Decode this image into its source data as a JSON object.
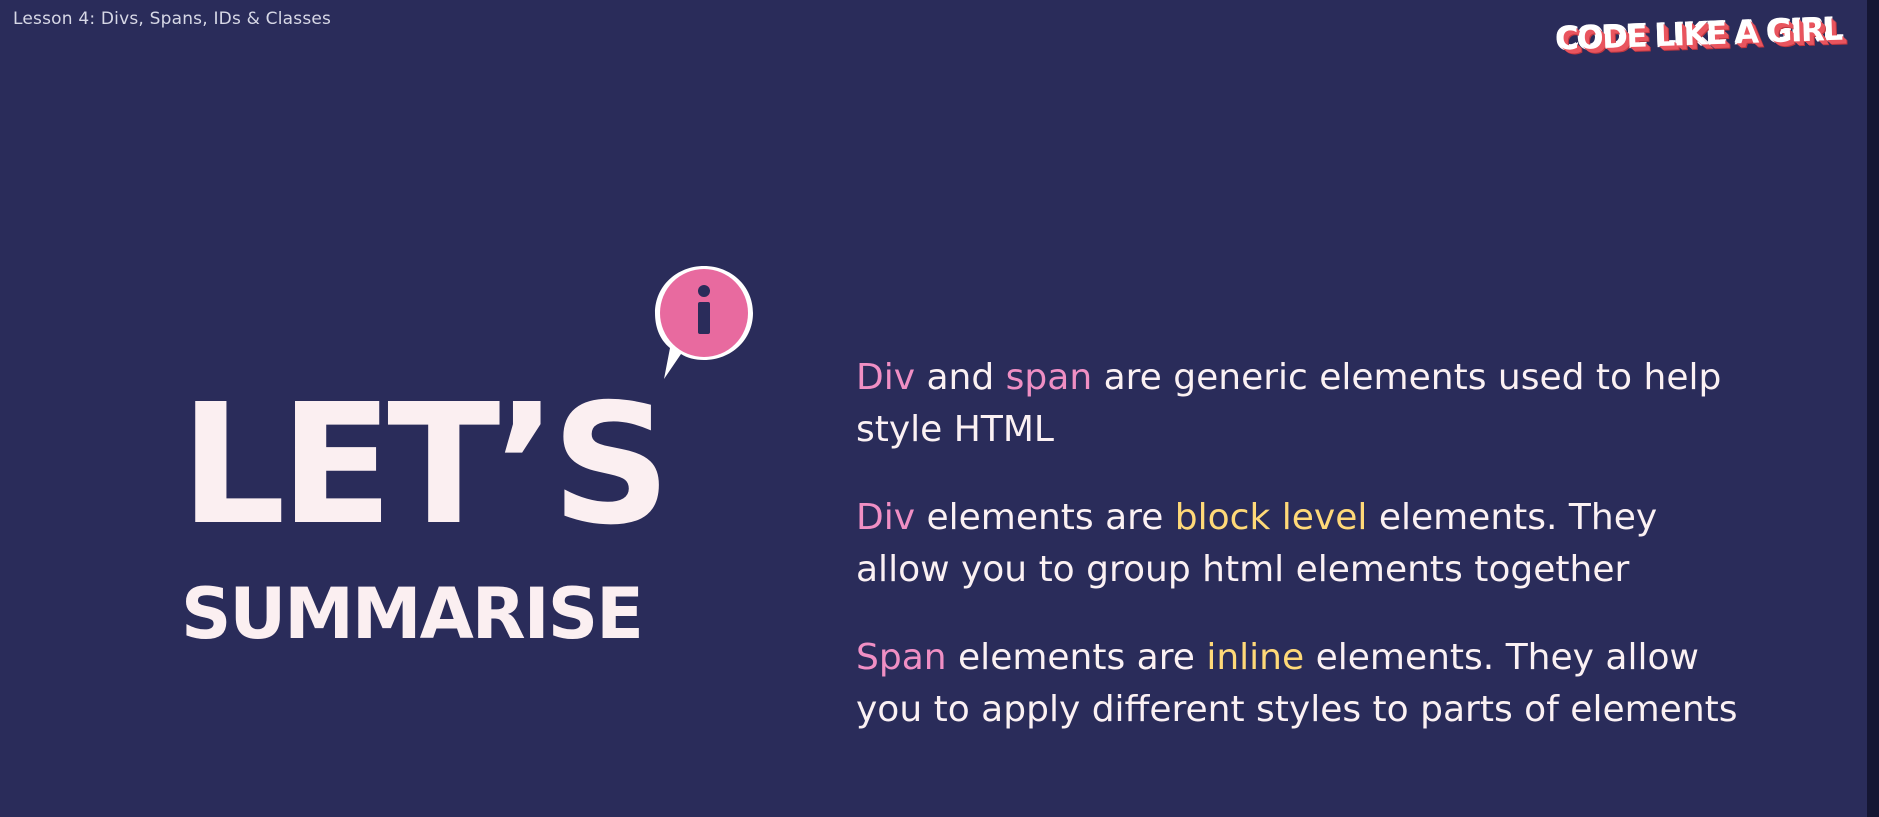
{
  "slide": {
    "lesson_title": "Lesson 4: Divs, Spans, IDs & Classes",
    "logo_text": "CODE LIKE A GIRL",
    "icon": "info-speech-bubble-icon",
    "headline": "LET’S",
    "subheadline": "SUMMARISE",
    "colors": {
      "background": "#2a2c5a",
      "text": "#fbf1f3",
      "highlight_pink": "#f08fc4",
      "highlight_yellow": "#ffd978",
      "icon_pink": "#e86a9f",
      "logo_red": "#e9555e"
    },
    "points": [
      {
        "lines": [
          [
            {
              "text": "Div",
              "style": "pink"
            },
            {
              "text": " and ",
              "style": "normal"
            },
            {
              "text": "span",
              "style": "pink"
            },
            {
              "text": " are generic elements used to help",
              "style": "normal"
            }
          ],
          [
            {
              "text": "style HTML",
              "style": "normal"
            }
          ]
        ]
      },
      {
        "lines": [
          [
            {
              "text": "Div",
              "style": "pink"
            },
            {
              "text": " elements are ",
              "style": "normal"
            },
            {
              "text": "block level",
              "style": "yellow"
            },
            {
              "text": " elements. They",
              "style": "normal"
            }
          ],
          [
            {
              "text": "allow you to group html elements together",
              "style": "normal"
            }
          ]
        ]
      },
      {
        "lines": [
          [
            {
              "text": "Span",
              "style": "pink"
            },
            {
              "text": " elements are ",
              "style": "normal"
            },
            {
              "text": "inline",
              "style": "yellow"
            },
            {
              "text": " elements. They allow",
              "style": "normal"
            }
          ],
          [
            {
              "text": "you to apply different styles to parts of elements",
              "style": "normal"
            }
          ]
        ]
      }
    ]
  }
}
